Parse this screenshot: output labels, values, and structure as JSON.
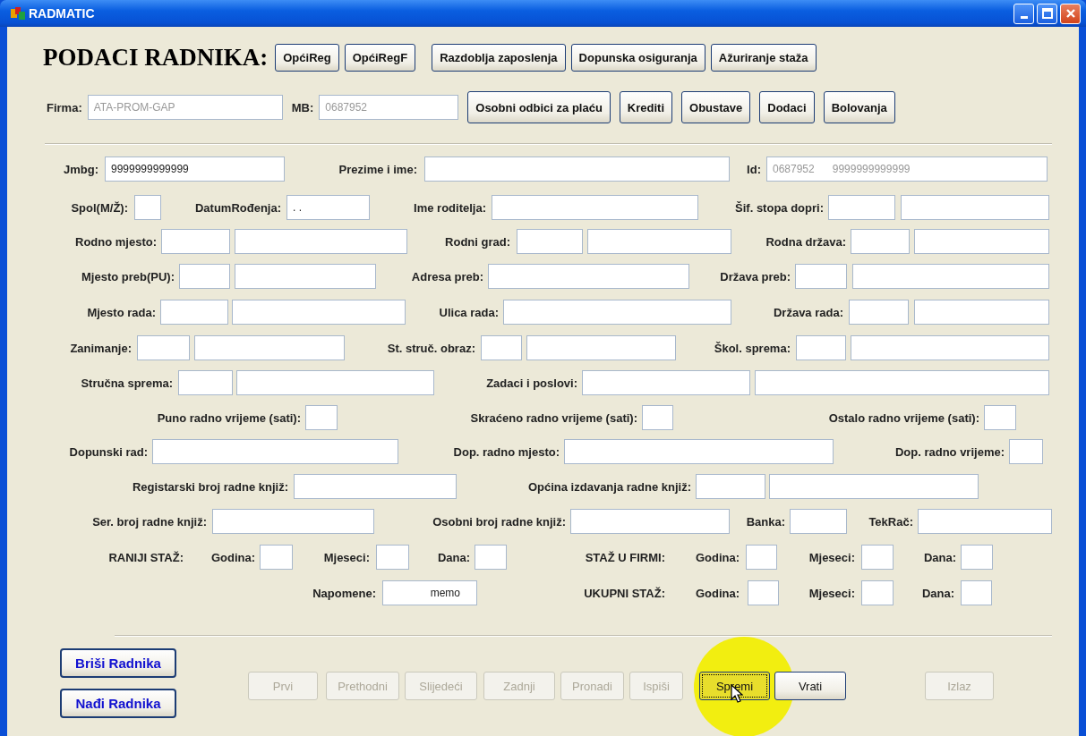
{
  "window": {
    "title": "RADMATIC"
  },
  "header": {
    "title": "PODACI RADNIKA:",
    "top_buttons": [
      {
        "label": "OpćiReg"
      },
      {
        "label": "OpćiRegF"
      },
      {
        "label": "Razdoblja zaposlenja"
      },
      {
        "label": "Dopunska osiguranja"
      },
      {
        "label": "Ažuriranje staža"
      }
    ],
    "firma": {
      "label": "Firma:",
      "value": "ATA-PROM-GAP",
      "disabled": true
    },
    "mb": {
      "label": "MB:",
      "value": "0687952",
      "disabled": true
    },
    "bottom_buttons": [
      {
        "label": "Osobni odbici za plaću"
      },
      {
        "label": "Krediti"
      },
      {
        "label": "Obustave"
      },
      {
        "label": "Dodaci"
      },
      {
        "label": "Bolovanja"
      }
    ]
  },
  "form_rows": [
    {
      "items": [
        {
          "kind": "label",
          "text": "Jmbg:"
        },
        {
          "kind": "field",
          "value": "9999999999999",
          "disabled": false
        },
        {
          "kind": "label",
          "text": "Prezime i ime:"
        },
        {
          "kind": "field"
        },
        {
          "kind": "label",
          "text": "Id:"
        },
        {
          "kind": "field",
          "value": "0687952      9999999999999",
          "disabled": true
        }
      ]
    },
    {
      "items": [
        {
          "kind": "label",
          "text": "Spol(M/Ž):"
        },
        {
          "kind": "field"
        },
        {
          "kind": "label",
          "text": "DatumRođenja:"
        },
        {
          "kind": "field",
          "value": ". .",
          "disabled": false
        },
        {
          "kind": "label",
          "text": "Ime roditelja:"
        },
        {
          "kind": "field"
        },
        {
          "kind": "label",
          "text": "Šif. stopa dopri:"
        },
        {
          "kind": "field"
        },
        {
          "kind": "field"
        }
      ]
    },
    {
      "items": [
        {
          "kind": "label",
          "text": "Rodno mjesto:"
        },
        {
          "kind": "field"
        },
        {
          "kind": "field"
        },
        {
          "kind": "label",
          "text": "Rodni grad:"
        },
        {
          "kind": "field"
        },
        {
          "kind": "field"
        },
        {
          "kind": "label",
          "text": "Rodna država:"
        },
        {
          "kind": "field"
        },
        {
          "kind": "field"
        }
      ]
    },
    {
      "items": [
        {
          "kind": "label",
          "text": "Mjesto preb(PU):"
        },
        {
          "kind": "field"
        },
        {
          "kind": "field"
        },
        {
          "kind": "label",
          "text": "Adresa preb:"
        },
        {
          "kind": "field"
        },
        {
          "kind": "label",
          "text": "Država preb:"
        },
        {
          "kind": "field"
        },
        {
          "kind": "field"
        }
      ]
    },
    {
      "items": [
        {
          "kind": "label",
          "text": "Mjesto rada:"
        },
        {
          "kind": "field"
        },
        {
          "kind": "field"
        },
        {
          "kind": "label",
          "text": "Ulica rada:"
        },
        {
          "kind": "field"
        },
        {
          "kind": "label",
          "text": "Država rada:"
        },
        {
          "kind": "field"
        },
        {
          "kind": "field"
        }
      ]
    },
    {
      "items": [
        {
          "kind": "label",
          "text": "Zanimanje:"
        },
        {
          "kind": "field"
        },
        {
          "kind": "field"
        },
        {
          "kind": "label",
          "text": "St. struč. obraz:"
        },
        {
          "kind": "field"
        },
        {
          "kind": "field"
        },
        {
          "kind": "label",
          "text": "Škol. sprema:"
        },
        {
          "kind": "field"
        },
        {
          "kind": "field"
        }
      ]
    },
    {
      "items": [
        {
          "kind": "label",
          "text": "Stručna sprema:"
        },
        {
          "kind": "field"
        },
        {
          "kind": "field"
        },
        {
          "kind": "label",
          "text": "Zadaci i poslovi:"
        },
        {
          "kind": "field"
        },
        {
          "kind": "field"
        }
      ]
    },
    {
      "items": [
        {
          "kind": "label",
          "text": "Puno radno vrijeme (sati):"
        },
        {
          "kind": "field"
        },
        {
          "kind": "label",
          "text": "Skraćeno radno vrijeme (sati):"
        },
        {
          "kind": "field"
        },
        {
          "kind": "label",
          "text": "Ostalo radno vrijeme (sati):"
        },
        {
          "kind": "field"
        }
      ]
    },
    {
      "items": [
        {
          "kind": "label",
          "text": "Dopunski rad:"
        },
        {
          "kind": "field"
        },
        {
          "kind": "label",
          "text": "Dop. radno mjesto:"
        },
        {
          "kind": "field"
        },
        {
          "kind": "label",
          "text": "Dop. radno vrijeme:"
        },
        {
          "kind": "field"
        }
      ]
    },
    {
      "items": [
        {
          "kind": "label",
          "text": "Registarski broj radne knjiž:"
        },
        {
          "kind": "field"
        },
        {
          "kind": "label",
          "text": "Općina izdavanja radne knjiž:"
        },
        {
          "kind": "field"
        },
        {
          "kind": "field"
        }
      ]
    },
    {
      "items": [
        {
          "kind": "label",
          "text": "Ser. broj radne knjiž:"
        },
        {
          "kind": "field"
        },
        {
          "kind": "label",
          "text": "Osobni broj radne knjiž:"
        },
        {
          "kind": "field"
        },
        {
          "kind": "label",
          "text": "Banka:"
        },
        {
          "kind": "field"
        },
        {
          "kind": "label",
          "text": "TekRač:"
        },
        {
          "kind": "field"
        }
      ]
    },
    {
      "items": [
        {
          "kind": "label",
          "text": "RANIJI STAŽ:"
        },
        {
          "kind": "label",
          "text": "Godina:"
        },
        {
          "kind": "field"
        },
        {
          "kind": "label",
          "text": "Mjeseci:"
        },
        {
          "kind": "field"
        },
        {
          "kind": "label",
          "text": "Dana:"
        },
        {
          "kind": "field"
        },
        {
          "kind": "label",
          "text": "STAŽ U FIRMI:"
        },
        {
          "kind": "label",
          "text": "Godina:"
        },
        {
          "kind": "field"
        },
        {
          "kind": "label",
          "text": "Mjeseci:"
        },
        {
          "kind": "field"
        },
        {
          "kind": "label",
          "text": "Dana:"
        },
        {
          "kind": "field"
        }
      ]
    },
    {
      "items": [
        {
          "kind": "label",
          "text": "Napomene:"
        },
        {
          "kind": "field",
          "value": "memo",
          "disabled": false
        },
        {
          "kind": "label",
          "text": "UKUPNI STAŽ:"
        },
        {
          "kind": "label",
          "text": "Godina:"
        },
        {
          "kind": "field"
        },
        {
          "kind": "label",
          "text": "Mjeseci:"
        },
        {
          "kind": "field"
        },
        {
          "kind": "label",
          "text": "Dana:"
        },
        {
          "kind": "field"
        }
      ]
    }
  ],
  "record_buttons": [
    {
      "label": "Briši Radnika"
    },
    {
      "label": "Nađi Radnika"
    }
  ],
  "nav_buttons": [
    {
      "label": "Prvi",
      "disabled": true,
      "focused": false
    },
    {
      "label": "Prethodni",
      "disabled": true,
      "focused": false
    },
    {
      "label": "Slijedeći",
      "disabled": true,
      "focused": false
    },
    {
      "label": "Zadnji",
      "disabled": true,
      "focused": false
    },
    {
      "label": "Pronadi",
      "disabled": true,
      "focused": false
    },
    {
      "label": "Ispiši",
      "disabled": true,
      "focused": false
    },
    {
      "label": "Spremi",
      "disabled": false,
      "focused": true
    },
    {
      "label": "Vrati",
      "disabled": false,
      "focused": false
    },
    {
      "label": "Izlaz",
      "disabled": true,
      "focused": false
    }
  ]
}
